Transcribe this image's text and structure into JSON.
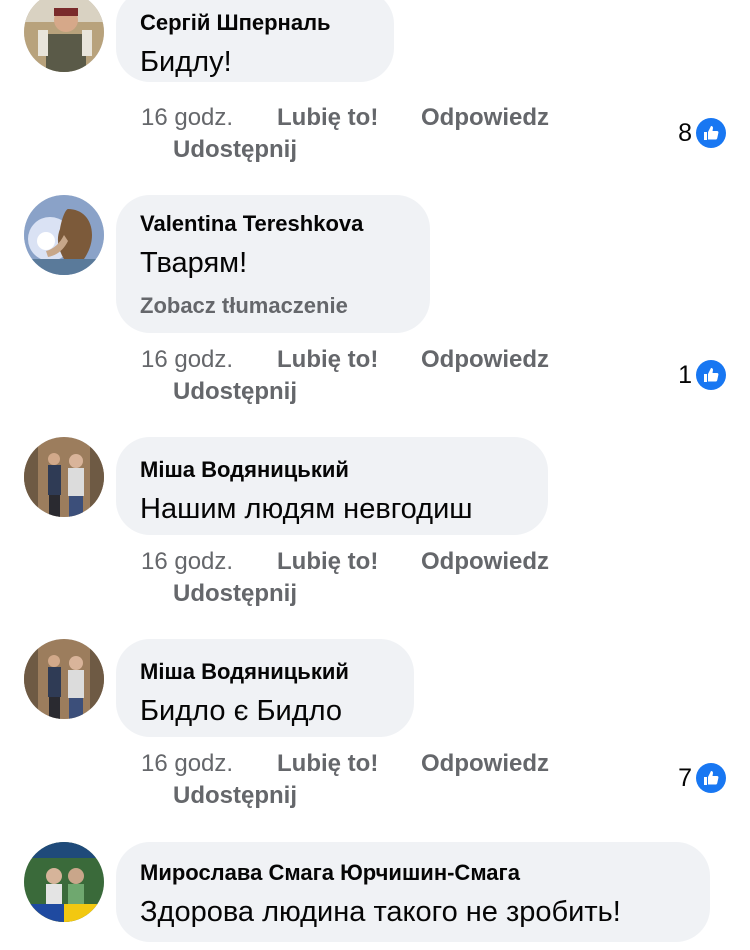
{
  "comments": [
    {
      "author": "Сергій Шперналь",
      "text": "Бидлу!",
      "time": "16 godz.",
      "like_label": "Lubię to!",
      "reply_label": "Odpowiedz",
      "share_label": "Udostępnij",
      "reactions": "8"
    },
    {
      "author": "Valentina Tereshkova",
      "text": "Тварям!",
      "translate_label": "Zobacz tłumaczenie",
      "time": "16 godz.",
      "like_label": "Lubię to!",
      "reply_label": "Odpowiedz",
      "share_label": "Udostępnij",
      "reactions": "1"
    },
    {
      "author": "Міша Водяницький",
      "text": "Нашим  людям невгодиш",
      "time": "16 godz.",
      "like_label": "Lubię to!",
      "reply_label": "Odpowiedz",
      "share_label": "Udostępnij"
    },
    {
      "author": "Міша Водяницький",
      "text": "Бидло  є Бидло",
      "time": "16 godz.",
      "like_label": "Lubię to!",
      "reply_label": "Odpowiedz",
      "share_label": "Udostępnij",
      "reactions": "7"
    },
    {
      "author": "Мирослава Смага Юрчишин-Смага",
      "text": "Здорова людина такого не зробить!"
    }
  ],
  "colors": {
    "bubble": "#f0f2f5",
    "meta_text": "#65676b",
    "like_blue": "#1877f2"
  },
  "icons": {
    "reaction": "like-thumbs-up-icon"
  }
}
